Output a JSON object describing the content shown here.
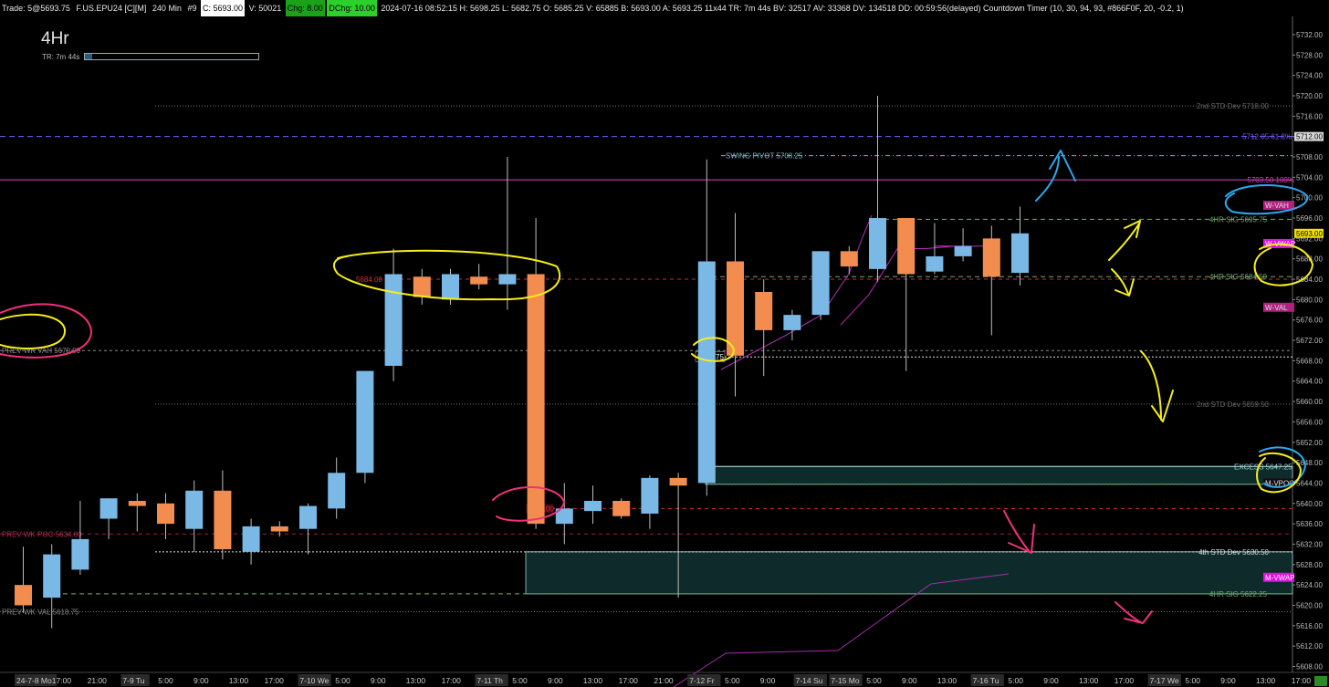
{
  "topbar": {
    "trade": "Trade: 5@5693.75",
    "symbol": "F.US.EPU24 [C][M]",
    "interval": "240 Min",
    "bar": "#9",
    "close": "C: 5693.00",
    "volume": "V: 50021",
    "chg": "Chg: 8.00",
    "dchg": "DChg: 10.00",
    "stats": "2024-07-16 08:52:15 H: 5698.25 L: 5682.75 O: 5685.25 V: 65885 B: 5693.00 A: 5693.25 11x44 TR: 7m 44s BV: 32517 AV: 33368 DV: 134518 DD: 00:59:56(delayed) Countdown Timer  (10, 30, 94, 93, #866F0F, 20, -0.2, 1)"
  },
  "timeframe": "4Hr",
  "timer": {
    "label": "TR: 7m 44s",
    "progress": 0.04
  },
  "colors": {
    "background": "#000000",
    "up": "#7ab8e6",
    "down": "#f28d4f",
    "wick": "#bdbdbd",
    "magenta_line": "#e040c0",
    "purple_line": "#7a5cff",
    "red_dash": "#d02a3a",
    "green_dash": "#6fae6f",
    "zone": "#0f2a2a",
    "zone_border": "#9fd8d8",
    "annotation_yellow": "#f5ee1a",
    "annotation_pink": "#f0307a",
    "annotation_blue": "#2aa8f0"
  },
  "chart_data": {
    "type": "candlestick",
    "price_axis": {
      "range": [
        5608,
        5734
      ],
      "ticks": [
        5608,
        5612,
        5616,
        5620,
        5624,
        5628,
        5632,
        5636,
        5640,
        5644,
        5648,
        5652,
        5656,
        5660,
        5664,
        5668,
        5672,
        5676,
        5680,
        5684,
        5688,
        5692,
        5696,
        5700,
        5704,
        5708,
        5712,
        5716,
        5720,
        5724,
        5728,
        5732
      ],
      "tick_labels": [
        "5608.00",
        "5612.00",
        "5616.00",
        "5620.00",
        "5624.00",
        "5628.00",
        "5632.00",
        "5636.00",
        "5640.00",
        "5644.00",
        "5648.00",
        "5652.00",
        "5656.00",
        "5660.00",
        "5664.00",
        "5668.00",
        "5672.00",
        "5676.00",
        "5680.00",
        "5684.00",
        "5688.00",
        "5692.00",
        "5696.00",
        "5700.00",
        "5704.00",
        "5708.00",
        "5712.00",
        "5716.00",
        "5720.00",
        "5724.00",
        "5728.00",
        "5732.00"
      ]
    },
    "time_axis": [
      "24-7-8 Mo",
      "17:00",
      "21:00",
      "7-9 Tu",
      "5:00",
      "9:00",
      "13:00",
      "17:00",
      "7-10 We",
      "5:00",
      "9:00",
      "13:00",
      "17:00",
      "7-11 Th",
      "5:00",
      "9:00",
      "13:00",
      "17:00",
      "21:00",
      "7-12 Fr",
      "5:00",
      "9:00",
      "7-14 Su",
      "7-15 Mo",
      "5:00",
      "9:00",
      "13:00",
      "7-16 Tu",
      "5:00",
      "9:00",
      "13:00",
      "17:00",
      "7-17 We",
      "5:00",
      "9:00",
      "13:00",
      "17:00"
    ],
    "candles": [
      {
        "o": 5624.0,
        "h": 5631.5,
        "l": 5618.5,
        "c": 5620.0
      },
      {
        "o": 5621.5,
        "h": 5632.0,
        "l": 5615.5,
        "c": 5630.0
      },
      {
        "o": 5627.0,
        "h": 5640.5,
        "l": 5626.0,
        "c": 5633.0
      },
      {
        "o": 5637.0,
        "h": 5641.0,
        "l": 5633.0,
        "c": 5641.0
      },
      {
        "o": 5640.5,
        "h": 5642.0,
        "l": 5634.5,
        "c": 5639.5
      },
      {
        "o": 5640.0,
        "h": 5642.0,
        "l": 5633.0,
        "c": 5636.0
      },
      {
        "o": 5635.0,
        "h": 5644.5,
        "l": 5630.5,
        "c": 5642.5
      },
      {
        "o": 5642.5,
        "h": 5646.5,
        "l": 5629.0,
        "c": 5631.0
      },
      {
        "o": 5630.5,
        "h": 5637.0,
        "l": 5628.0,
        "c": 5635.5
      },
      {
        "o": 5635.5,
        "h": 5636.5,
        "l": 5633.5,
        "c": 5634.5
      },
      {
        "o": 5635.0,
        "h": 5640.0,
        "l": 5630.0,
        "c": 5639.5
      },
      {
        "o": 5639.0,
        "h": 5649.0,
        "l": 5637.0,
        "c": 5646.0
      },
      {
        "o": 5646.0,
        "h": 5666.0,
        "l": 5644.0,
        "c": 5666.0
      },
      {
        "o": 5667.0,
        "h": 5690.0,
        "l": 5664.0,
        "c": 5685.0
      },
      {
        "o": 5684.5,
        "h": 5686.0,
        "l": 5679.0,
        "c": 5680.5
      },
      {
        "o": 5680.0,
        "h": 5686.0,
        "l": 5679.0,
        "c": 5685.0
      },
      {
        "o": 5684.5,
        "h": 5687.0,
        "l": 5682.0,
        "c": 5683.0
      },
      {
        "o": 5683.0,
        "h": 5708.0,
        "l": 5678.0,
        "c": 5685.0
      },
      {
        "o": 5685.0,
        "h": 5696.0,
        "l": 5635.0,
        "c": 5636.0
      },
      {
        "o": 5636.0,
        "h": 5644.0,
        "l": 5632.0,
        "c": 5639.0
      },
      {
        "o": 5638.5,
        "h": 5643.5,
        "l": 5636.0,
        "c": 5640.5
      },
      {
        "o": 5640.5,
        "h": 5641.0,
        "l": 5637.0,
        "c": 5637.5
      },
      {
        "o": 5638.0,
        "h": 5645.5,
        "l": 5635.0,
        "c": 5645.0
      },
      {
        "o": 5645.0,
        "h": 5646.0,
        "l": 5621.5,
        "c": 5643.5
      },
      {
        "o": 5644.0,
        "h": 5707.5,
        "l": 5641.5,
        "c": 5687.5
      },
      {
        "o": 5687.5,
        "h": 5697.0,
        "l": 5661.0,
        "c": 5669.0
      },
      {
        "o": 5681.5,
        "h": 5684.0,
        "l": 5665.0,
        "c": 5674.0
      },
      {
        "o": 5674.0,
        "h": 5678.0,
        "l": 5672.0,
        "c": 5677.0
      },
      {
        "o": 5677.0,
        "h": 5689.5,
        "l": 5676.0,
        "c": 5689.5
      },
      {
        "o": 5689.5,
        "h": 5690.5,
        "l": 5685.0,
        "c": 5686.5
      },
      {
        "o": 5686.0,
        "h": 5720.0,
        "l": 5683.5,
        "c": 5696.0
      },
      {
        "o": 5696.0,
        "h": 5696.0,
        "l": 5666.0,
        "c": 5685.0
      },
      {
        "o": 5685.5,
        "h": 5695.0,
        "l": 5685.0,
        "c": 5688.5
      },
      {
        "o": 5688.5,
        "h": 5694.0,
        "l": 5687.5,
        "c": 5690.5
      },
      {
        "o": 5692.0,
        "h": 5694.5,
        "l": 5673.0,
        "c": 5684.5
      },
      {
        "o": 5685.25,
        "h": 5698.25,
        "l": 5682.75,
        "c": 5693.0
      }
    ],
    "levels": [
      {
        "label": "2nd STD Dev",
        "value": "5718.00",
        "price": 5718.0,
        "style": "dotted-gray"
      },
      {
        "label": "5712.05 61.8%",
        "value": "5712.00",
        "price": 5712.0,
        "style": "dashed-purple"
      },
      {
        "label": "SWING PIVOT",
        "value": "5708.25",
        "price": 5708.25,
        "style": "dashdot-teal"
      },
      {
        "label": "5703.50 100%",
        "value": "",
        "price": 5703.5,
        "style": "solid-magenta"
      },
      {
        "label": "4HR SIG",
        "value": "5695.75",
        "price": 5695.75,
        "style": "dashed-green"
      },
      {
        "label": "4HR SIG",
        "value": "5684.50",
        "price": 5684.5,
        "style": "dashed-green"
      },
      {
        "label": "",
        "value": "5684.00",
        "price": 5684.0,
        "style": "dashed-red"
      },
      {
        "label": "PREV WK VAH",
        "value": "5670.00",
        "price": 5670.0,
        "style": "dashed-gray"
      },
      {
        "label": "",
        "value": "5668.75",
        "price": 5668.75,
        "style": "dotted-white"
      },
      {
        "label": "2nd STD Dev",
        "value": "5659.50",
        "price": 5659.5,
        "style": "dotted-gray"
      },
      {
        "label": "EXCESS",
        "value": "5647.25",
        "price": 5647.25,
        "style": "solid-teal"
      },
      {
        "label": "",
        "value": "5643.75",
        "price": 5643.75,
        "style": "dotted-green"
      },
      {
        "label": "",
        "value": "5639.00",
        "price": 5639.0,
        "style": "dashed-red"
      },
      {
        "label": "PREV WK POC",
        "value": "5634.00",
        "price": 5634.0,
        "style": "dashed-darkred"
      },
      {
        "label": "4th STD Dev",
        "value": "5630.50",
        "price": 5630.5,
        "style": "dotted-white"
      },
      {
        "label": "4HR SIG",
        "value": "5622.25",
        "price": 5622.25,
        "style": "dashed-green"
      },
      {
        "label": "PREV WK VAL",
        "value": "5618.75",
        "price": 5618.75,
        "style": "dotted-gray"
      }
    ],
    "price_tags": [
      {
        "text": "5712.00",
        "price": 5712.0,
        "bg": "#d8d8d8",
        "fg": "#000"
      },
      {
        "text": "W-VAH",
        "price": 5698.5,
        "bg": "#b0207f",
        "fg": "#ddd"
      },
      {
        "text": "5693.00",
        "price": 5693.0,
        "bg": "#f0e000",
        "fg": "#000"
      },
      {
        "text": "W-VWAP",
        "price": 5691.0,
        "bg": "#e010e0",
        "fg": "#fff"
      },
      {
        "text": "W-VAL",
        "price": 5678.5,
        "bg": "#b0207f",
        "fg": "#ddd"
      },
      {
        "text": "M-VPOC",
        "price": 5644.0,
        "bg": "#101010",
        "fg": "#ddd"
      },
      {
        "text": "M-VWAP",
        "price": 5625.5,
        "bg": "#e010e0",
        "fg": "#fff"
      }
    ],
    "weekly_vwap": [
      [
        29,
        5675.0
      ],
      [
        30,
        5681.0
      ],
      [
        31,
        5690.0
      ],
      [
        32,
        5690.0
      ],
      [
        33,
        5690.5
      ]
    ],
    "monthly_vwap": [
      [
        23.5,
        5608.0
      ],
      [
        25,
        5617.0
      ],
      [
        28.5,
        5618.0
      ],
      [
        30,
        5623.0
      ],
      [
        34,
        5625.5
      ]
    ]
  }
}
